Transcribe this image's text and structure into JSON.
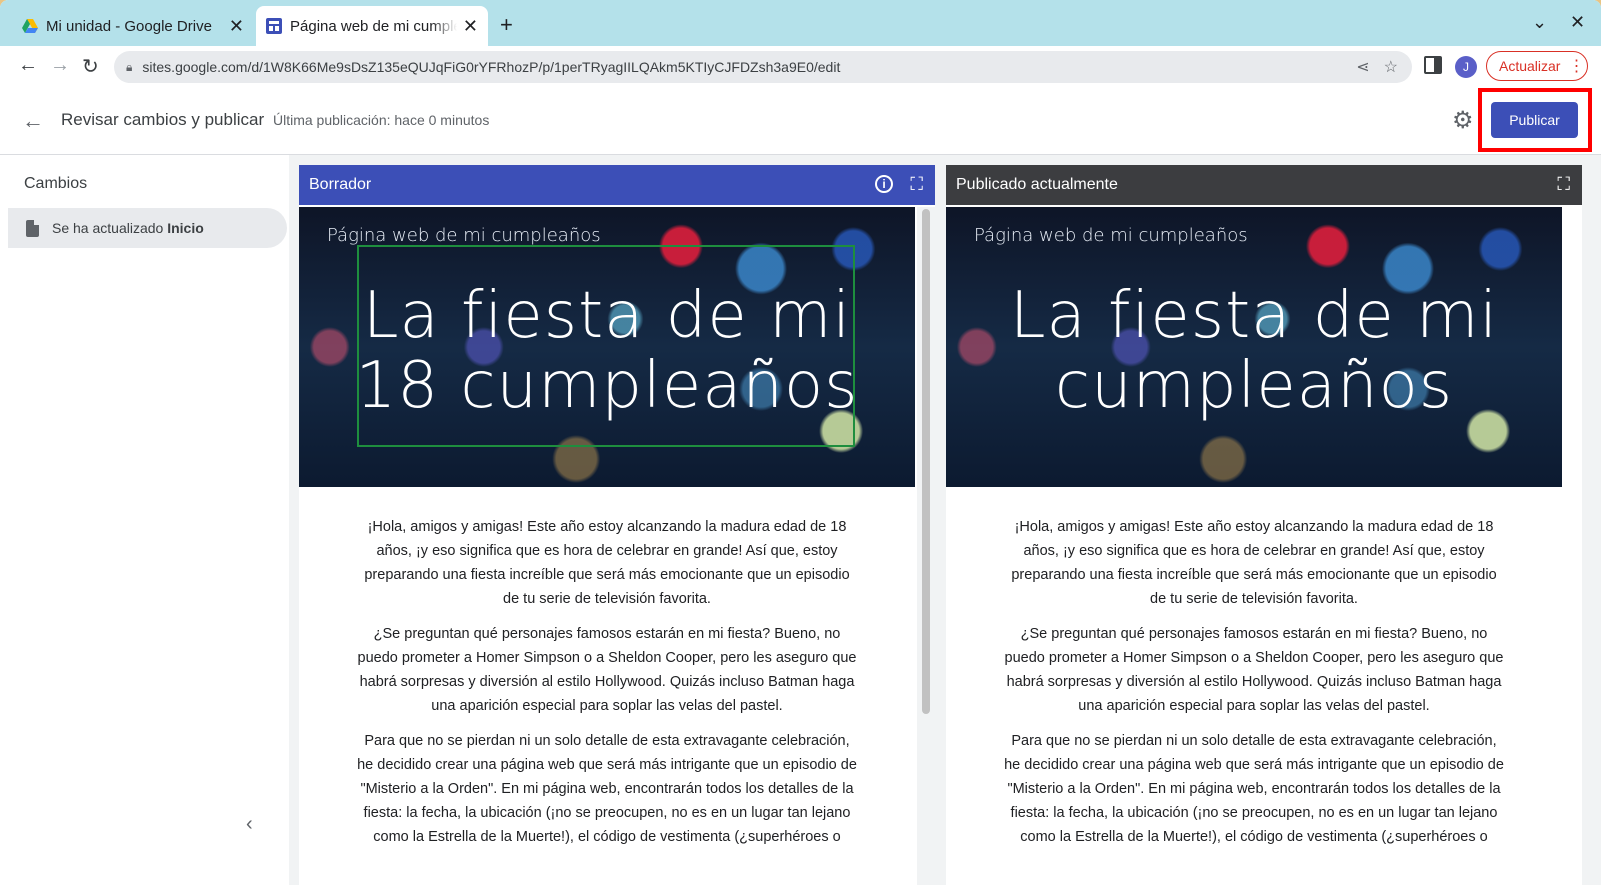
{
  "browser": {
    "tabs": [
      {
        "title": "Mi unidad - Google Drive",
        "close": "✕"
      },
      {
        "title": "Página web de mi cumpleaños",
        "close": "✕"
      }
    ],
    "new_tab": "+",
    "url": "sites.google.com/d/1W8K66Me9sDsZ135eQUJqFiG0rYFRhozP/p/1perTRyagIILQAkm5KTIyCJFDZsh3a9E0/edit",
    "avatar_letter": "J",
    "update_label": "Actualizar"
  },
  "header": {
    "title": "Revisar cambios y publicar",
    "last_publication": "Última publicación: hace 0 minutos",
    "publish_label": "Publicar"
  },
  "changes": {
    "title": "Cambios",
    "item_prefix": "Se ha actualizado",
    "item_page": "Inicio"
  },
  "draft": {
    "label": "Borrador",
    "site_name": "Página web de mi cumpleaños",
    "hero_line1": "La fiesta de mi",
    "hero_line2": "18 cumpleaños"
  },
  "published": {
    "label": "Publicado actualmente",
    "site_name": "Página web de mi cumpleaños",
    "hero_line1": "La fiesta de mi",
    "hero_line2": "cumpleaños"
  },
  "content": {
    "p1": "¡Hola, amigos y amigas! Este año estoy alcanzando la madura edad de 18 años, ¡y eso significa que es hora de celebrar en grande! Así que, estoy preparando una fiesta increíble que será más emocionante que un episodio de tu serie de televisión favorita.",
    "p2": "¿Se preguntan qué personajes famosos estarán en mi fiesta? Bueno, no puedo prometer a Homer Simpson o a Sheldon Cooper, pero les aseguro que habrá sorpresas y diversión al estilo Hollywood. Quizás incluso Batman haga una aparición especial para soplar las velas del pastel.",
    "p3": "Para que no se pierdan ni un solo detalle de esta extravagante celebración, he decidido crear una página web que será más intrigante que un episodio de \"Misterio a la Orden\". En mi página web, encontrarán todos los detalles de la fiesta: la fecha, la ubicación (¡no se preocupen, no es en un lugar tan lejano como la Estrella de la Muerte!), el código de vestimenta (¿superhéroes o"
  },
  "colors": {
    "accent": "#3c4fb7",
    "highlight": "#ff0000",
    "selection": "#1e8e3e"
  }
}
